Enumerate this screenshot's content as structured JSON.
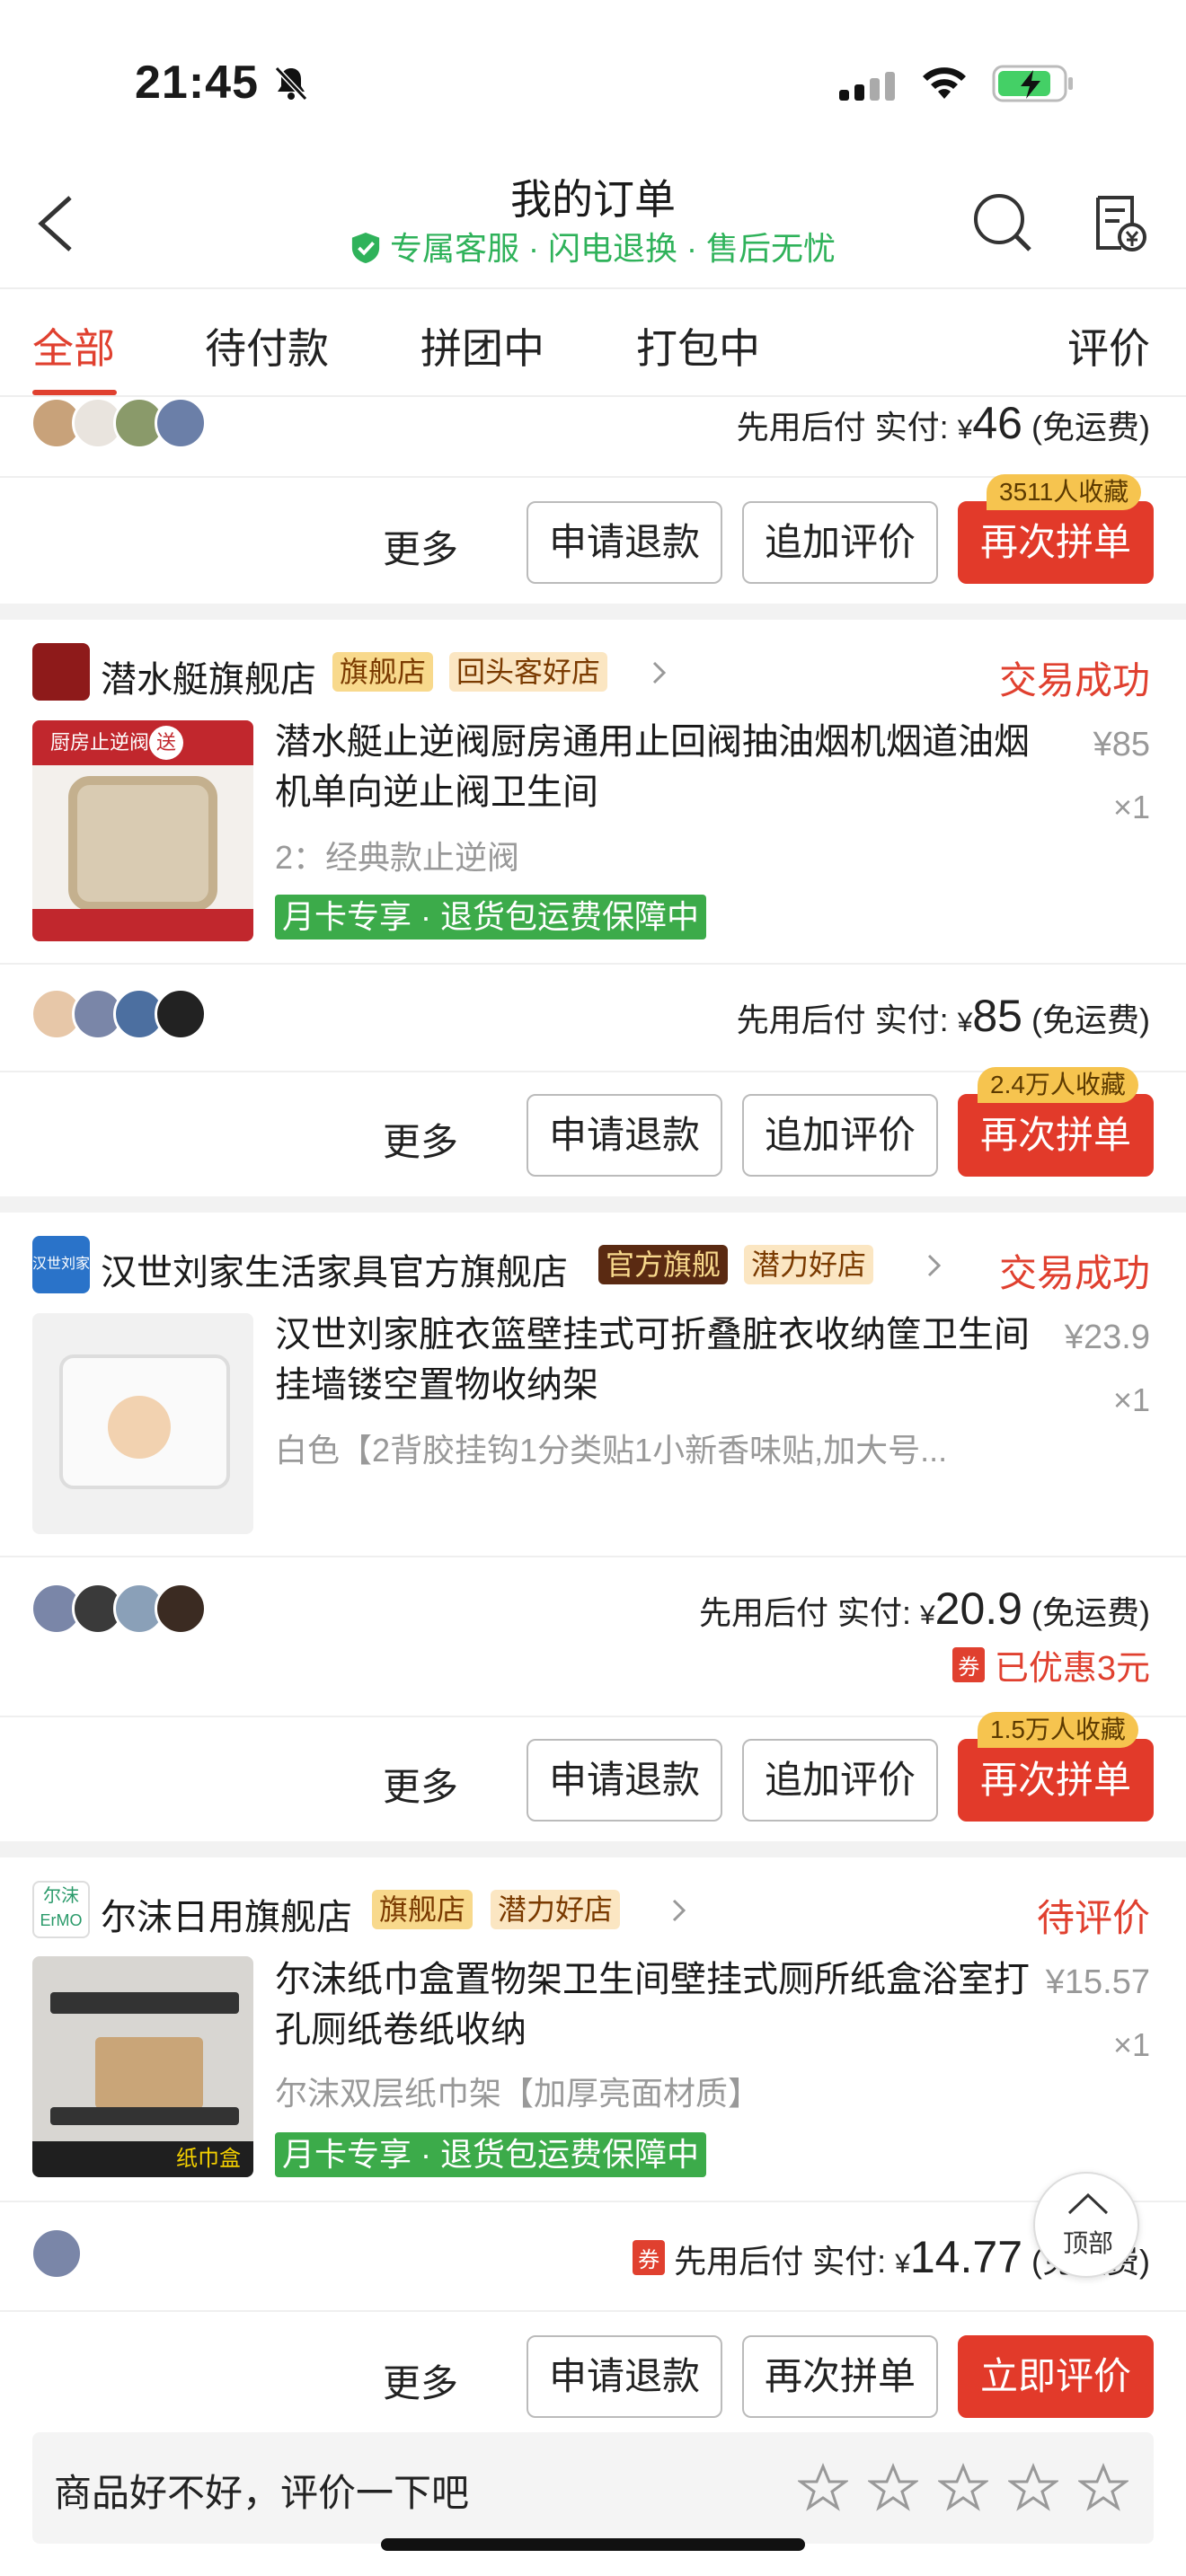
{
  "status_bar": {
    "time": "21:45"
  },
  "nav": {
    "title": "我的订单",
    "subtitle": "专属客服 · 闪电退换 · 售后无忧"
  },
  "tabs": [
    {
      "label": "全部"
    },
    {
      "label": "待付款"
    },
    {
      "label": "拼团中"
    },
    {
      "label": "打包中"
    },
    {
      "label": "评价"
    }
  ],
  "orders": [
    {
      "pay_prefix": "先用后付 实付: ",
      "currency": "¥",
      "amount": "46",
      "shipping": "(免运费)",
      "fav": "3511人收藏",
      "more": "更多",
      "btn1": "申请退款",
      "btn2": "追加评价",
      "btn3": "再次拼单"
    },
    {
      "store": "潜水艇旗舰店",
      "badge1": "旗舰店",
      "badge2": "回头客好店",
      "status": "交易成功",
      "title": "潜水艇止逆阀厨房通用止回阀抽油烟机烟道油烟机单向逆止阀卫生间",
      "variant": "2：经典款止逆阀",
      "price": "¥85",
      "qty": "×1",
      "promo": "月卡专享 · 退货包运费保障中",
      "pay_prefix": "先用后付 实付: ",
      "currency": "¥",
      "amount": "85",
      "shipping": "(免运费)",
      "fav": "2.4万人收藏",
      "more": "更多",
      "btn1": "申请退款",
      "btn2": "追加评价",
      "btn3": "再次拼单",
      "thumb_text": "厨房止逆阀",
      "thumb_badge": "送"
    },
    {
      "store": "汉世刘家生活家具官方旗舰店",
      "badge1": "官方旗舰",
      "badge2": "潜力好店",
      "status": "交易成功",
      "title": "汉世刘家脏衣篮壁挂式可折叠脏衣收纳筐卫生间挂墙镂空置物收纳架",
      "variant": "白色【2背胶挂钩1分类贴1小新香味贴,加大号...",
      "price": "¥23.9",
      "qty": "×1",
      "pay_prefix": "先用后付 实付: ",
      "currency": "¥",
      "amount": "20.9",
      "shipping": "(免运费)",
      "discount_icon": "券",
      "discount": "已优惠3元",
      "fav": "1.5万人收藏",
      "more": "更多",
      "btn1": "申请退款",
      "btn2": "追加评价",
      "btn3": "再次拼单",
      "logo_text": "汉世刘家"
    },
    {
      "store": "尔沫日用旗舰店",
      "badge1": "旗舰店",
      "badge2": "潜力好店",
      "status": "待评价",
      "title": "尔沫纸巾盒置物架卫生间壁挂式厕所纸盒浴室打孔厕纸卷纸收纳",
      "variant": "尔沫双层纸巾架【加厚亮面材质】",
      "price": "¥15.57",
      "qty": "×1",
      "promo": "月卡专享 · 退货包运费保障中",
      "coupon_icon": "券",
      "pay_prefix": "先用后付 实付: ",
      "currency": "¥",
      "amount": "14.77",
      "shipping": "(免运费)",
      "more": "更多",
      "btn1": "申请退款",
      "btn2": "再次拼单",
      "btn3": "立即评价",
      "logo_text": "尔沫",
      "logo_sub": "ErMO",
      "thumb_text": "纸巾盒"
    }
  ],
  "rate": {
    "prompt": "商品好不好，评价一下吧"
  },
  "top_button": {
    "label": "顶部"
  },
  "colors": {
    "accent": "#e0402f",
    "green": "#3cab4a",
    "badge_gold": "#f6c44f"
  }
}
